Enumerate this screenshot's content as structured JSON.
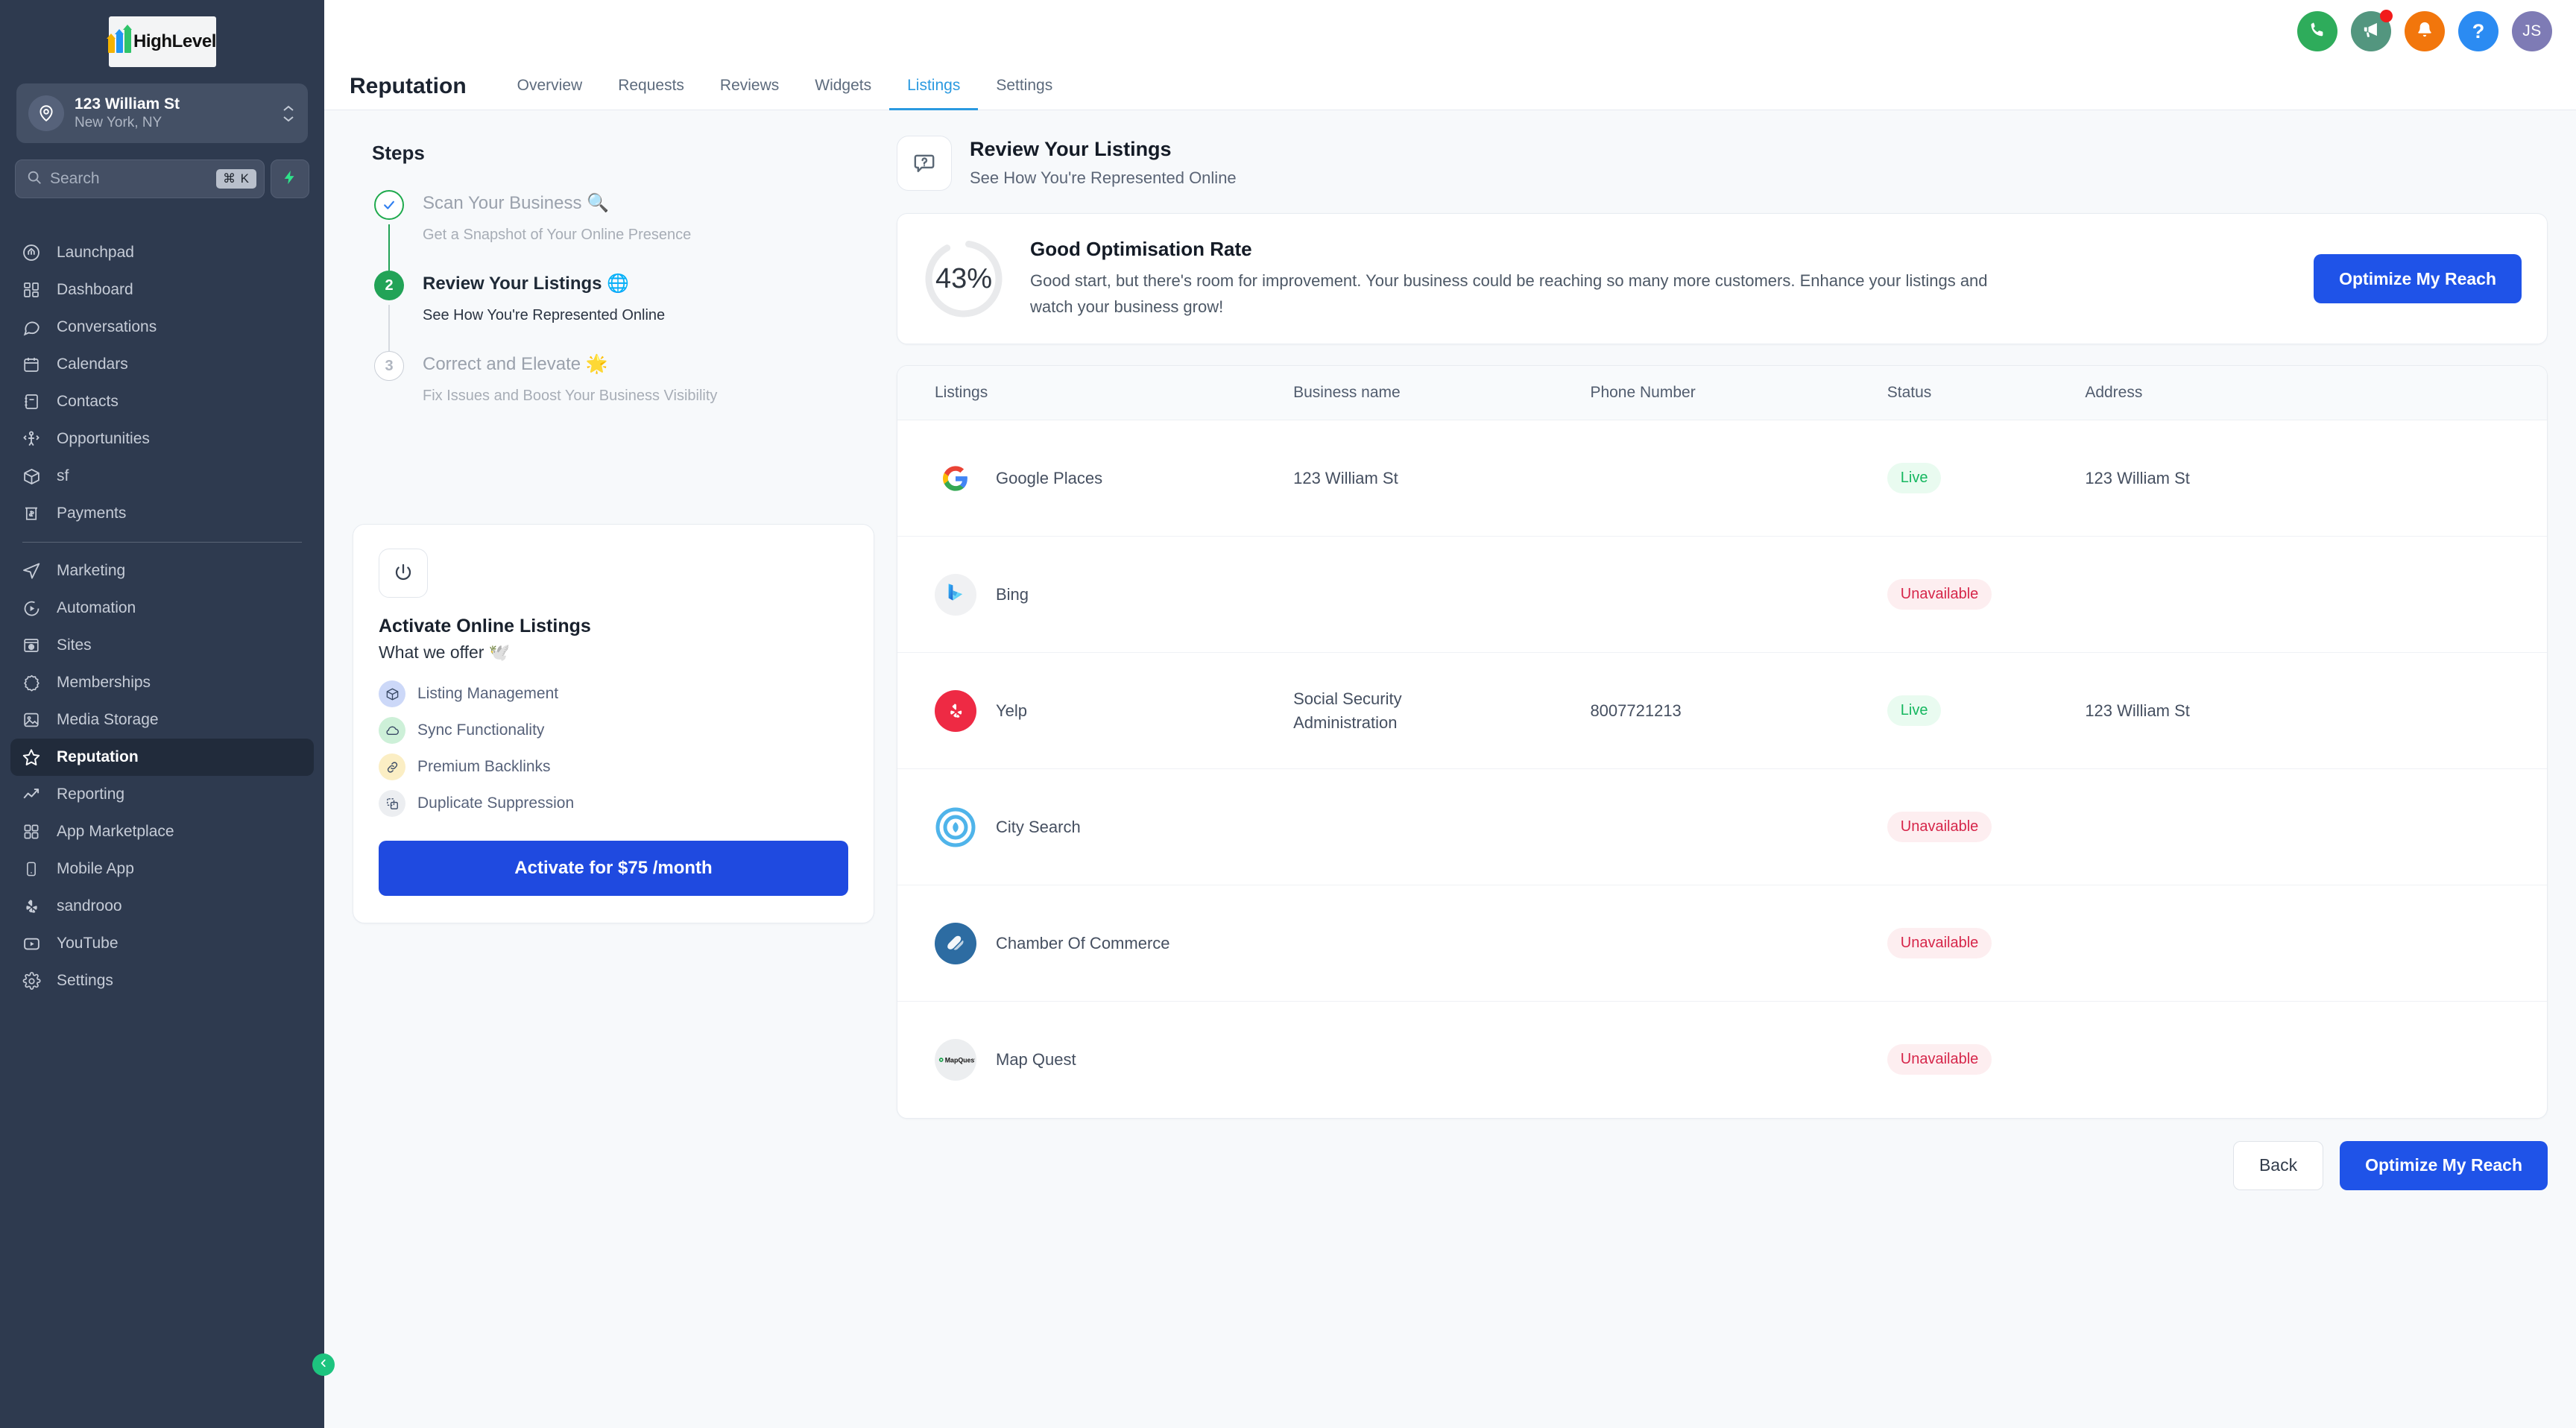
{
  "sidebar": {
    "logo_text": "HighLevel",
    "location": {
      "name": "123 William St",
      "sub": "New York, NY"
    },
    "search": {
      "placeholder": "Search",
      "shortcut": "⌘ K"
    },
    "nav_top": [
      {
        "label": "Launchpad",
        "icon": "launchpad-icon"
      },
      {
        "label": "Dashboard",
        "icon": "dashboard-icon"
      },
      {
        "label": "Conversations",
        "icon": "conversations-icon"
      },
      {
        "label": "Calendars",
        "icon": "calendar-icon"
      },
      {
        "label": "Contacts",
        "icon": "contacts-icon"
      },
      {
        "label": "Opportunities",
        "icon": "opportunities-icon"
      },
      {
        "label": "sf",
        "icon": "box-icon"
      },
      {
        "label": "Payments",
        "icon": "payments-icon"
      }
    ],
    "nav_bottom": [
      {
        "label": "Marketing",
        "icon": "marketing-icon"
      },
      {
        "label": "Automation",
        "icon": "automation-icon"
      },
      {
        "label": "Sites",
        "icon": "sites-icon"
      },
      {
        "label": "Memberships",
        "icon": "memberships-icon"
      },
      {
        "label": "Media Storage",
        "icon": "media-storage-icon"
      },
      {
        "label": "Reputation",
        "icon": "star-icon",
        "active": true
      },
      {
        "label": "Reporting",
        "icon": "reporting-icon"
      },
      {
        "label": "App Marketplace",
        "icon": "app-marketplace-icon"
      },
      {
        "label": "Mobile App",
        "icon": "mobile-app-icon"
      },
      {
        "label": "sandrooo",
        "icon": "yelp-icon"
      },
      {
        "label": "YouTube",
        "icon": "youtube-icon"
      },
      {
        "label": "Settings",
        "icon": "gear-icon"
      }
    ]
  },
  "topbar": {
    "icons": [
      "phone-icon",
      "megaphone-icon",
      "bell-icon",
      "help-icon"
    ],
    "avatar_initials": "JS"
  },
  "header": {
    "page_title": "Reputation",
    "tabs": [
      {
        "label": "Overview",
        "active": false
      },
      {
        "label": "Requests",
        "active": false
      },
      {
        "label": "Reviews",
        "active": false
      },
      {
        "label": "Widgets",
        "active": false
      },
      {
        "label": "Listings",
        "active": true
      },
      {
        "label": "Settings",
        "active": false
      }
    ]
  },
  "steps_panel": {
    "title": "Steps",
    "steps": [
      {
        "marker": "✓",
        "title": "Scan Your Business 🔍",
        "sub": "Get a Snapshot of Your Online Presence",
        "state": "done"
      },
      {
        "marker": "2",
        "title": "Review Your Listings 🌐",
        "sub": "See How You're Represented Online",
        "state": "current"
      },
      {
        "marker": "3",
        "title": "Correct and Elevate 🌟",
        "sub": "Fix Issues and Boost Your Business Visibility",
        "state": "todo"
      }
    ]
  },
  "activate_card": {
    "icon": "power-icon",
    "title": "Activate Online Listings",
    "subtitle": "What we offer 🕊️",
    "features": [
      {
        "label": "Listing Management",
        "icon": "box-icon",
        "tone": "blue"
      },
      {
        "label": "Sync Functionality",
        "icon": "cloud-icon",
        "tone": "green"
      },
      {
        "label": "Premium Backlinks",
        "icon": "link-icon",
        "tone": "amber"
      },
      {
        "label": "Duplicate Suppression",
        "icon": "copy-icon",
        "tone": "grey"
      }
    ],
    "cta": "Activate for $75 /month"
  },
  "review": {
    "icon": "question-bubble-icon",
    "title": "Review Your Listings",
    "subtitle": "See How You're Represented Online"
  },
  "optimisation": {
    "percent_label": "43%",
    "percent_value": 43,
    "arc_color": "#E0A311",
    "track_color": "#E9EAEC",
    "title": "Good Optimisation Rate",
    "description": "Good start, but there's room for improvement. Your business could be reaching so many more customers. Enhance your listings and watch your business grow!",
    "cta": "Optimize My Reach"
  },
  "table": {
    "columns": [
      "Listings",
      "Business name",
      "Phone Number",
      "Status",
      "Address"
    ],
    "rows": [
      {
        "logo": "google-icon",
        "listing": "Google Places",
        "business": "123 William St",
        "phone": "",
        "status": "Live",
        "status_tone": "live",
        "address": "123 William St"
      },
      {
        "logo": "bing-icon",
        "listing": "Bing",
        "business": "",
        "phone": "",
        "status": "Unavailable",
        "status_tone": "unavailable",
        "address": ""
      },
      {
        "logo": "yelp-icon",
        "listing": "Yelp",
        "business": "Social Security Administration",
        "phone": "8007721213",
        "status": "Live",
        "status_tone": "live",
        "address": "123 William St"
      },
      {
        "logo": "citysearch-icon",
        "listing": "City Search",
        "business": "",
        "phone": "",
        "status": "Unavailable",
        "status_tone": "unavailable",
        "address": ""
      },
      {
        "logo": "chamber-icon",
        "listing": "Chamber Of Commerce",
        "business": "",
        "phone": "",
        "status": "Unavailable",
        "status_tone": "unavailable",
        "address": ""
      },
      {
        "logo": "mapquest-icon",
        "listing": "Map Quest",
        "business": "",
        "phone": "",
        "status": "Unavailable",
        "status_tone": "unavailable",
        "address": ""
      }
    ]
  },
  "footer": {
    "back": "Back",
    "primary": "Optimize My Reach"
  }
}
